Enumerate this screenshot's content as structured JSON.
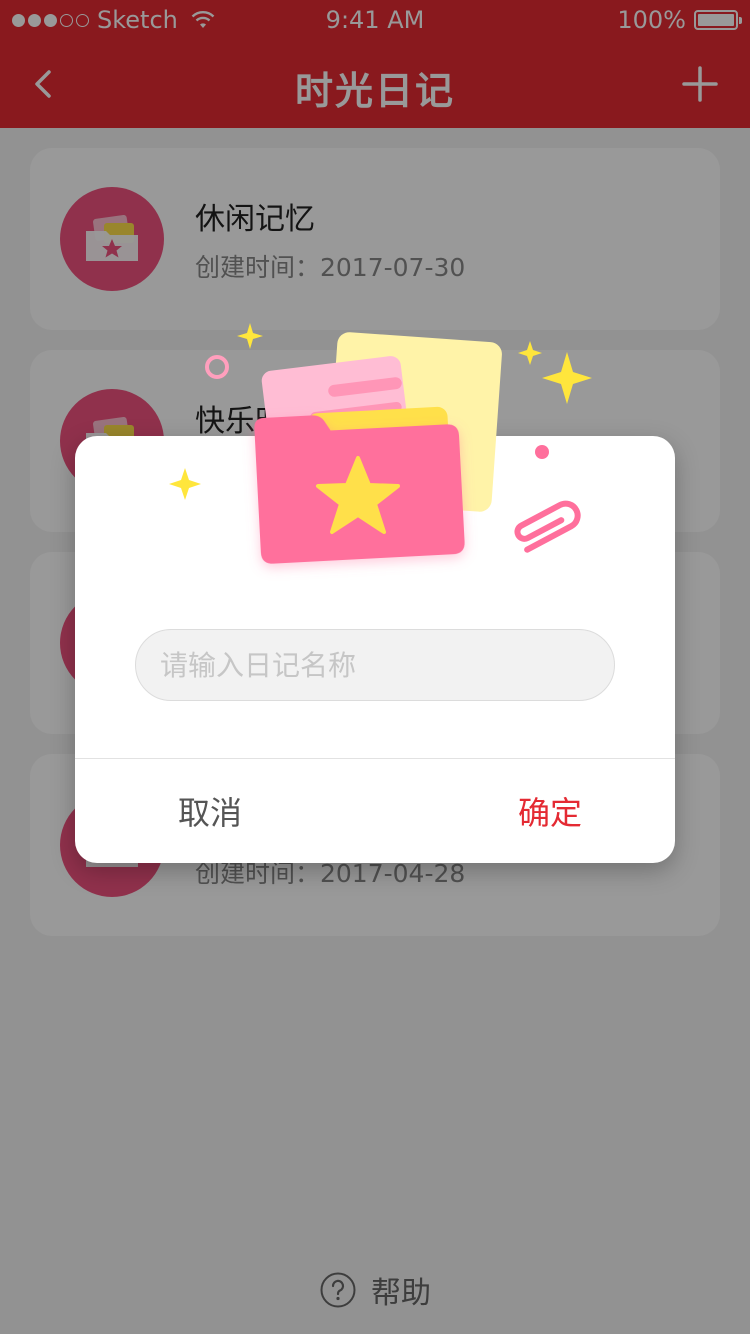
{
  "status_bar": {
    "carrier": "Sketch",
    "time": "9:41 AM",
    "battery": "100%"
  },
  "nav": {
    "title": "时光日记",
    "back_icon": "chevron-left-icon",
    "add_icon": "plus-icon"
  },
  "diaries": [
    {
      "title": "休闲记忆",
      "date": "创建时间：2017-07-30"
    },
    {
      "title": "快乐时光",
      "date": ""
    },
    {
      "title": "",
      "date": ""
    },
    {
      "title": "",
      "date": "创建时间：2017-04-28"
    }
  ],
  "help": {
    "label": "帮助",
    "icon": "question-circle-icon"
  },
  "dialog": {
    "input_placeholder": "请输入日记名称",
    "input_value": "",
    "cancel": "取消",
    "confirm": "确定"
  },
  "colors": {
    "brand": "#e42a33",
    "icon_bg": "#f0537f",
    "folder_pink": "#ff6f9c",
    "folder_yellow": "#ffe04a",
    "sparkle": "#ffe63c"
  }
}
